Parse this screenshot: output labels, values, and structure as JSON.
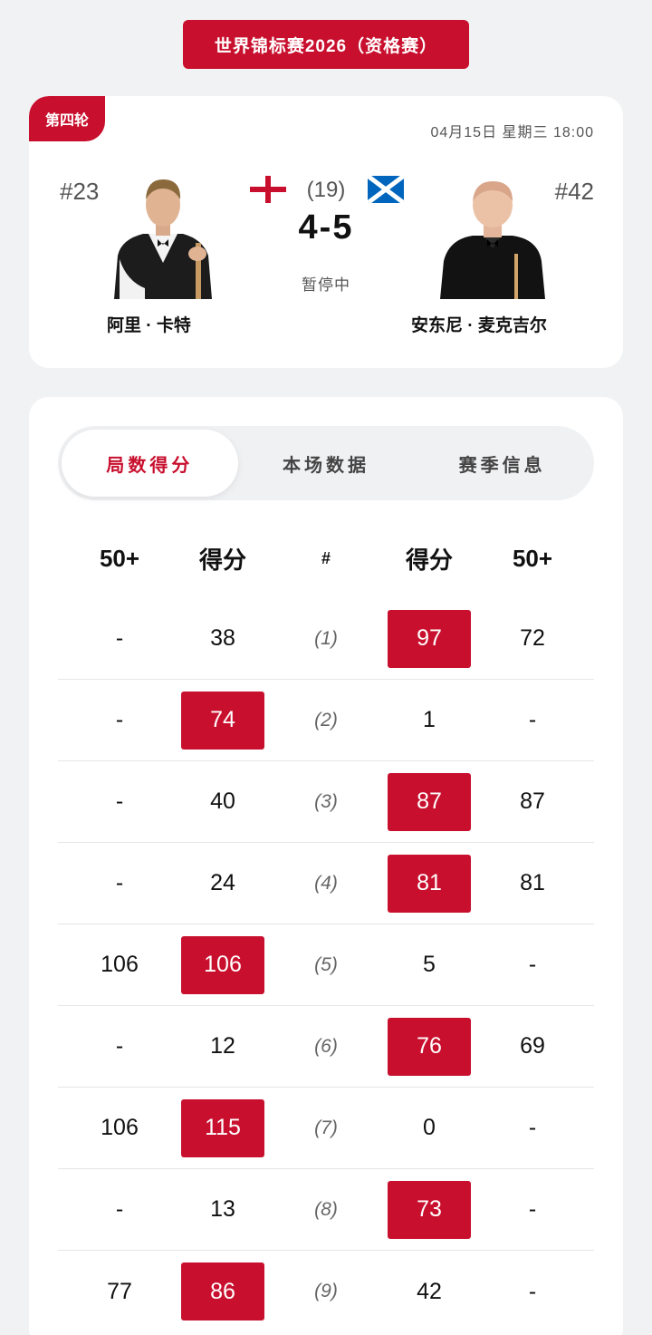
{
  "event": {
    "title": "世界锦标赛2026（资格赛）"
  },
  "match": {
    "round": "第四轮",
    "datetime": "04月15日  星期三  18:00",
    "best_of": "(19)",
    "score": "4-5",
    "status": "暂停中",
    "player_left": {
      "seed": "#23",
      "name": "阿里 · 卡特",
      "flag": "england-flag-icon"
    },
    "player_right": {
      "seed": "#42",
      "name": "安东尼 · 麦克吉尔",
      "flag": "scotland-flag-icon"
    }
  },
  "tabs": [
    {
      "label": "局数得分",
      "active": true
    },
    {
      "label": "本场数据",
      "active": false
    },
    {
      "label": "赛季信息",
      "active": false
    }
  ],
  "table": {
    "headers": {
      "left_break": "50+",
      "left_score": "得分",
      "frame": "#",
      "right_score": "得分",
      "right_break": "50+"
    },
    "rows": [
      {
        "left_break": "-",
        "left_score": "38",
        "frame": "(1)",
        "right_score": "97",
        "right_break": "72",
        "winner": "right"
      },
      {
        "left_break": "-",
        "left_score": "74",
        "frame": "(2)",
        "right_score": "1",
        "right_break": "-",
        "winner": "left"
      },
      {
        "left_break": "-",
        "left_score": "40",
        "frame": "(3)",
        "right_score": "87",
        "right_break": "87",
        "winner": "right"
      },
      {
        "left_break": "-",
        "left_score": "24",
        "frame": "(4)",
        "right_score": "81",
        "right_break": "81",
        "winner": "right"
      },
      {
        "left_break": "106",
        "left_score": "106",
        "frame": "(5)",
        "right_score": "5",
        "right_break": "-",
        "winner": "left"
      },
      {
        "left_break": "-",
        "left_score": "12",
        "frame": "(6)",
        "right_score": "76",
        "right_break": "69",
        "winner": "right"
      },
      {
        "left_break": "106",
        "left_score": "115",
        "frame": "(7)",
        "right_score": "0",
        "right_break": "-",
        "winner": "left"
      },
      {
        "left_break": "-",
        "left_score": "13",
        "frame": "(8)",
        "right_score": "73",
        "right_break": "-",
        "winner": "right"
      },
      {
        "left_break": "77",
        "left_score": "86",
        "frame": "(9)",
        "right_score": "42",
        "right_break": "-",
        "winner": "left"
      }
    ]
  },
  "colors": {
    "accent": "#c8102e",
    "background": "#f1f2f4",
    "card": "#ffffff"
  }
}
